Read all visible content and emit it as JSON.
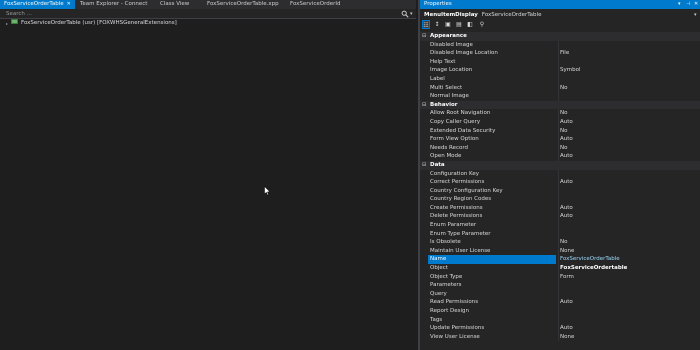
{
  "tabs": [
    {
      "label": "FoxServiceOrderTable",
      "active": true
    },
    {
      "label": "Team Explorer - Connect"
    },
    {
      "label": "Class View"
    },
    {
      "label": "FoxServiceOrderTable.xpp"
    },
    {
      "label": "FoxServiceOrderId"
    }
  ],
  "search": {
    "placeholder": "Search ..."
  },
  "tree": {
    "item_label": "FoxServiceOrderTable (usr) [FOXWHSGeneralExtensions]"
  },
  "properties": {
    "title": "Properties",
    "object_type": "MenuItemDisplay",
    "object_name": "FoxServiceOrderTable",
    "categories": [
      {
        "name": "Appearance",
        "rows": [
          {
            "name": "Disabled Image",
            "value": ""
          },
          {
            "name": "Disabled Image Location",
            "value": "File"
          },
          {
            "name": "Help Text",
            "value": ""
          },
          {
            "name": "Image Location",
            "value": "Symbol"
          },
          {
            "name": "Label",
            "value": ""
          },
          {
            "name": "Multi Select",
            "value": "No"
          },
          {
            "name": "Normal Image",
            "value": ""
          }
        ]
      },
      {
        "name": "Behavior",
        "rows": [
          {
            "name": "Allow Root Navigation",
            "value": "No"
          },
          {
            "name": "Copy Caller Query",
            "value": "Auto"
          },
          {
            "name": "Extended Data Security",
            "value": "No"
          },
          {
            "name": "Form View Option",
            "value": "Auto"
          },
          {
            "name": "Needs Record",
            "value": "No"
          },
          {
            "name": "Open Mode",
            "value": "Auto"
          }
        ]
      },
      {
        "name": "Data",
        "rows": [
          {
            "name": "Configuration Key",
            "value": ""
          },
          {
            "name": "Correct Permissions",
            "value": "Auto"
          },
          {
            "name": "Country Configuration Key",
            "value": ""
          },
          {
            "name": "Country Region Codes",
            "value": ""
          },
          {
            "name": "Create Permissions",
            "value": "Auto"
          },
          {
            "name": "Delete Permissions",
            "value": "Auto"
          },
          {
            "name": "Enum Parameter",
            "value": ""
          },
          {
            "name": "Enum Type Parameter",
            "value": ""
          },
          {
            "name": "Is Obsolete",
            "value": "No"
          },
          {
            "name": "Maintain User License",
            "value": "None"
          },
          {
            "name": "Name",
            "value": "FoxServiceOrderTable",
            "selected": true
          },
          {
            "name": "Object",
            "value": "FoxServiceOrdertable",
            "bold": true
          },
          {
            "name": "Object Type",
            "value": "Form"
          },
          {
            "name": "Parameters",
            "value": ""
          },
          {
            "name": "Query",
            "value": ""
          },
          {
            "name": "Read Permissions",
            "value": "Auto"
          },
          {
            "name": "Report Design",
            "value": ""
          },
          {
            "name": "Tags",
            "value": ""
          },
          {
            "name": "Update Permissions",
            "value": "Auto"
          },
          {
            "name": "View User License",
            "value": "None"
          }
        ]
      }
    ]
  },
  "colors": {
    "accent": "#007acc",
    "background": "#1e1e1e",
    "panel": "#252526"
  }
}
